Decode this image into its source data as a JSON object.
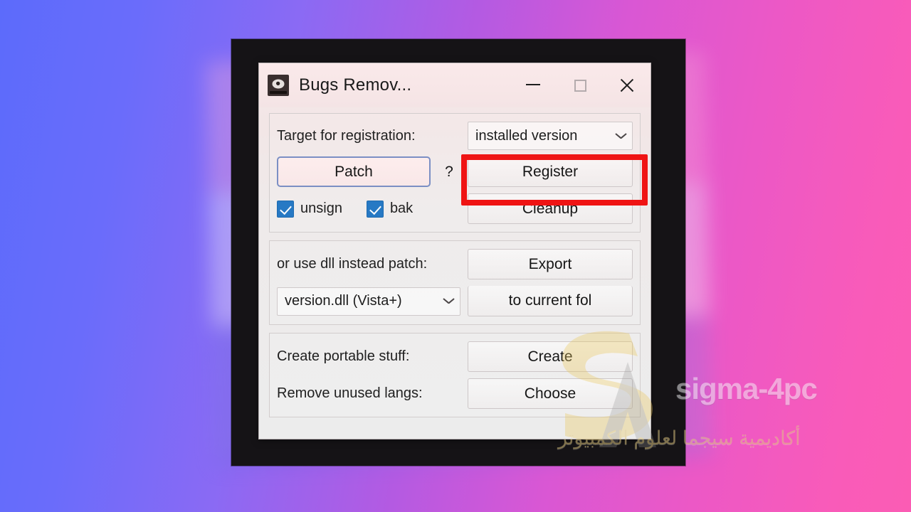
{
  "window": {
    "title": "Bugs Remov...",
    "icon": "app-disc-icon",
    "controls": {
      "minimize": "minimize-icon",
      "maximize": "maximize-icon",
      "close": "close-icon"
    }
  },
  "section_registration": {
    "target_label": "Target for registration:",
    "target_combo_value": "installed version",
    "patch_button": "Patch",
    "help_button": "?",
    "register_button": "Register",
    "unsign_checkbox": {
      "label": "unsign",
      "checked": true
    },
    "bak_checkbox": {
      "label": "bak",
      "checked": true
    },
    "cleanup_button": "Cleanup"
  },
  "section_dll": {
    "dll_label": "or use dll instead patch:",
    "export_button": "Export",
    "dll_combo_value": "version.dll (Vista+)",
    "to_current_button": "to current fol"
  },
  "section_extras": {
    "portable_label": "Create portable stuff:",
    "create_button": "Create",
    "langs_label": "Remove unused langs:",
    "choose_button": "Choose"
  },
  "watermark": {
    "brand": "sigma-4pc",
    "arabic": "أكاديمية سيجما لعلوم الكمبيوتر"
  },
  "colors": {
    "highlight": "#ef1414",
    "checkbox": "#2779c4",
    "default_button_border": "#7b8fc4",
    "backdrop": "#151316"
  }
}
